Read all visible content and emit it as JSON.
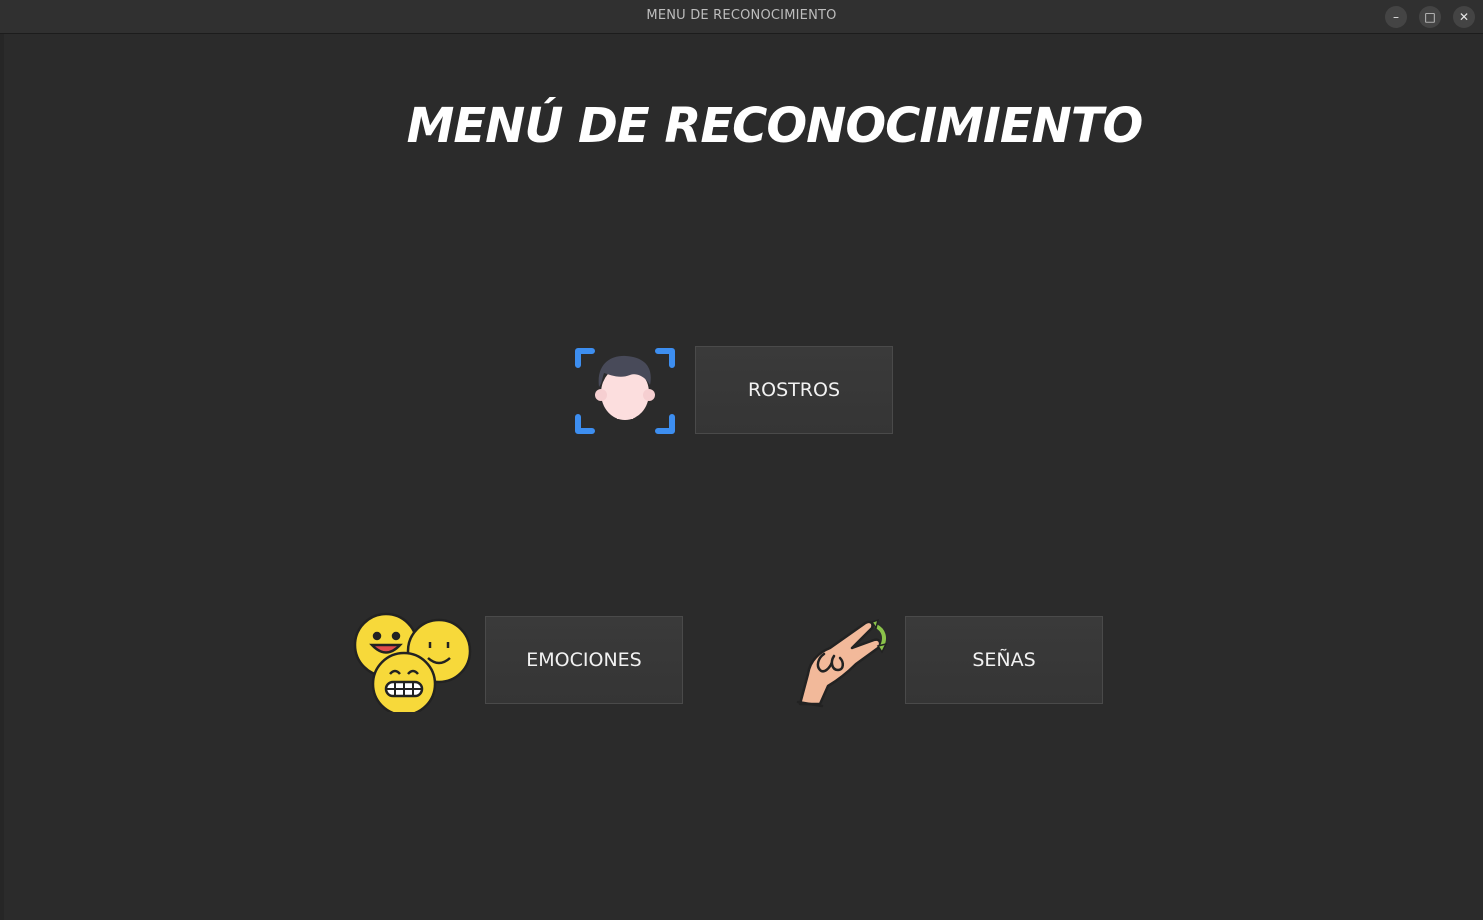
{
  "window": {
    "title": "MENU DE RECONOCIMIENTO",
    "controls": {
      "minimize": "–",
      "maximize": "□",
      "close": "✕"
    }
  },
  "main": {
    "title": "MENÚ DE RECONOCIMIENTO",
    "buttons": {
      "rostros": "ROSTROS",
      "emociones": "EMOCIONES",
      "senas": "SEÑAS"
    },
    "icons": {
      "rostros": "face-scan-icon",
      "emociones": "emoji-faces-icon",
      "senas": "sign-language-hand-icon"
    }
  },
  "colors": {
    "background": "#2b2b2b",
    "button": "#383838",
    "scan_frame": "#3d8ef0",
    "emoji_yellow": "#f7d93a"
  }
}
